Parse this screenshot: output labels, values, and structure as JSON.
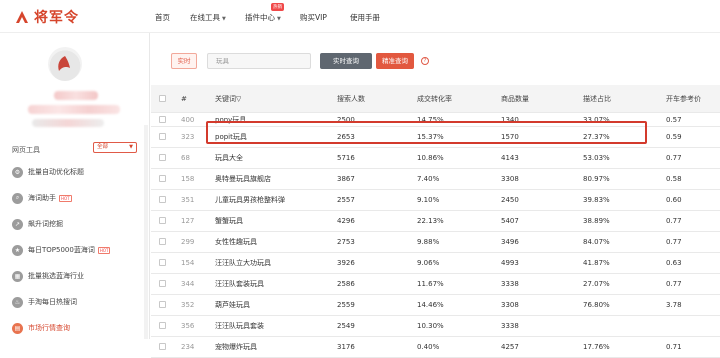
{
  "header": {
    "logo_text": "将军令",
    "nav": [
      {
        "label": "首页",
        "dropdown": false
      },
      {
        "label": "在线工具",
        "dropdown": true
      },
      {
        "label": "插件中心",
        "dropdown": true
      },
      {
        "label": "购买VIP",
        "dropdown": false
      },
      {
        "label": "使用手册",
        "dropdown": false
      }
    ],
    "badge": "热销"
  },
  "sidebar": {
    "tools_label": "网页工具",
    "tools_select": "全部",
    "items": [
      {
        "label": "批量自动优化标题",
        "icon": "settings-icon",
        "hot": false
      },
      {
        "label": "海词助手",
        "icon": "search-icon",
        "hot": true
      },
      {
        "label": "飙升词挖掘",
        "icon": "trend-icon",
        "hot": false
      },
      {
        "label": "每日TOP5000蓝海词",
        "icon": "star-icon",
        "hot": true
      },
      {
        "label": "批量挑选蓝海行业",
        "icon": "grid-icon",
        "hot": false
      },
      {
        "label": "手淘每日热搜词",
        "icon": "fire-icon",
        "hot": false
      },
      {
        "label": "市场行情查询",
        "icon": "chart-icon",
        "hot": false,
        "active": true
      }
    ],
    "hot_tag": "HOT"
  },
  "toolbar": {
    "tab_realtime": "实时",
    "search_placeholder": "玩具",
    "btn_query": "实时查询",
    "btn_precise": "精准查询",
    "help": "?"
  },
  "table": {
    "columns": [
      "",
      "#",
      "关键词▽",
      "搜索人数",
      "成交转化率",
      "商品数量",
      "描述占比",
      "开车参考价"
    ],
    "rows": [
      {
        "idx": "400",
        "keyword": "pony玩具",
        "search": "2500",
        "conv": "14.75%",
        "goods": "1340",
        "ratio": "33.07%",
        "price": "0.57"
      },
      {
        "idx": "323",
        "keyword": "popit玩具",
        "search": "2653",
        "conv": "15.37%",
        "goods": "1570",
        "ratio": "27.37%",
        "price": "0.59"
      },
      {
        "idx": "68",
        "keyword": "玩具大全",
        "search": "5716",
        "conv": "10.86%",
        "goods": "4143",
        "ratio": "53.03%",
        "price": "0.77"
      },
      {
        "idx": "158",
        "keyword": "奥特曼玩具旗舰店",
        "search": "3867",
        "conv": "7.40%",
        "goods": "3308",
        "ratio": "80.97%",
        "price": "0.58"
      },
      {
        "idx": "351",
        "keyword": "儿童玩具男孩枪整料弹",
        "search": "2557",
        "conv": "9.10%",
        "goods": "2450",
        "ratio": "39.83%",
        "price": "0.60"
      },
      {
        "idx": "127",
        "keyword": "蟹蟹玩具",
        "search": "4296",
        "conv": "22.13%",
        "goods": "5407",
        "ratio": "38.89%",
        "price": "0.77"
      },
      {
        "idx": "299",
        "keyword": "女性性趣玩具",
        "search": "2753",
        "conv": "9.88%",
        "goods": "3496",
        "ratio": "84.07%",
        "price": "0.77"
      },
      {
        "idx": "154",
        "keyword": "汪汪队立大功玩具",
        "search": "3926",
        "conv": "9.06%",
        "goods": "4993",
        "ratio": "41.87%",
        "price": "0.63"
      },
      {
        "idx": "344",
        "keyword": "汪汪队套装玩具",
        "search": "2586",
        "conv": "11.67%",
        "goods": "3338",
        "ratio": "27.07%",
        "price": "0.77"
      },
      {
        "idx": "352",
        "keyword": "葫芦娃玩具",
        "search": "2559",
        "conv": "14.46%",
        "goods": "3308",
        "ratio": "76.80%",
        "price": "3.78"
      },
      {
        "idx": "356",
        "keyword": "汪汪队玩具套装",
        "search": "2549",
        "conv": "10.30%",
        "goods": "3338",
        "ratio": "",
        "price": ""
      },
      {
        "idx": "234",
        "keyword": "宠物爆炸玩具",
        "search": "3176",
        "conv": "0.40%",
        "goods": "4257",
        "ratio": "17.76%",
        "price": "0.71"
      }
    ]
  },
  "colors": {
    "brand": "#d6452c",
    "highlight": "#d33a2c",
    "query_btn": "#5f6770"
  }
}
